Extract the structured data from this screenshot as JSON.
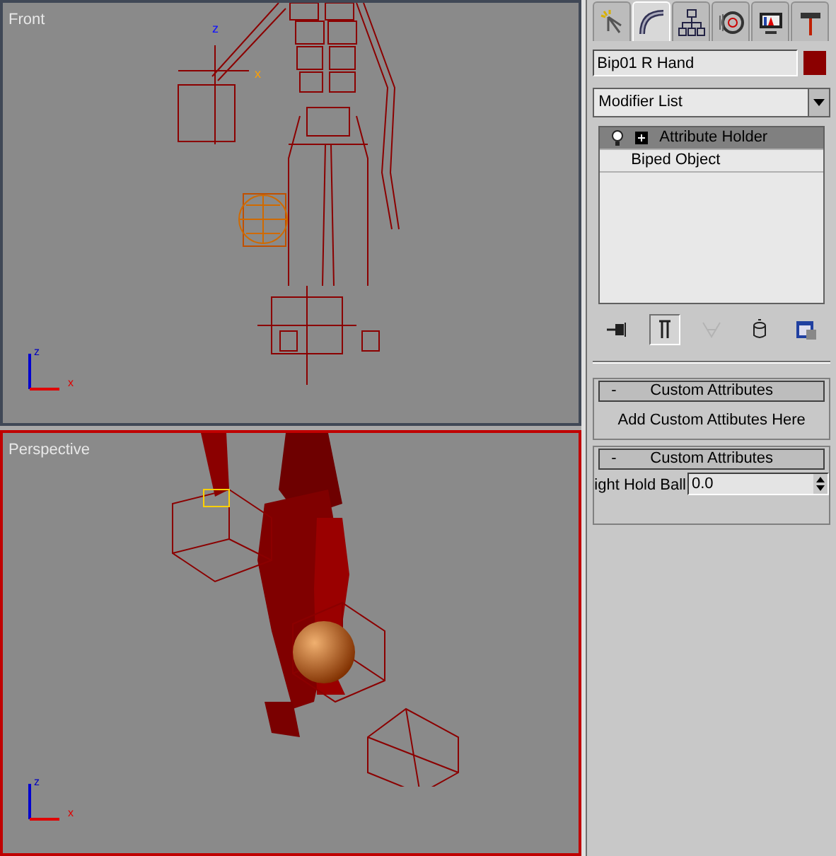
{
  "viewports": [
    {
      "title": "Front",
      "active": false,
      "kind": "front",
      "gizmo_labels": [
        "z",
        "x"
      ],
      "axis_labels": [
        "z",
        "x"
      ]
    },
    {
      "title": "Perspective",
      "active": true,
      "kind": "perspective",
      "axis_labels": [
        "z",
        "x"
      ]
    }
  ],
  "panel": {
    "tabs": [
      {
        "kind": "create",
        "selected": false
      },
      {
        "kind": "modify",
        "selected": true
      },
      {
        "kind": "hierarchy",
        "selected": false
      },
      {
        "kind": "motion",
        "selected": false
      },
      {
        "kind": "display",
        "selected": false
      },
      {
        "kind": "utilities",
        "selected": false
      }
    ],
    "object_name": "Bip01 R Hand",
    "modifier_list": "Modifier List",
    "stack_items": [
      {
        "label": "Attribute Holder",
        "selected": true,
        "expandable": true
      },
      {
        "label": "Biped Object",
        "selected": false,
        "expandable": false
      }
    ],
    "stack_toolbar": [
      {
        "kind": "pin",
        "selected": false,
        "disabled": false
      },
      {
        "kind": "show-end",
        "selected": true,
        "disabled": false
      },
      {
        "kind": "unique",
        "selected": false,
        "disabled": true
      },
      {
        "kind": "remove",
        "selected": false,
        "disabled": false
      },
      {
        "kind": "configure",
        "selected": false,
        "disabled": false
      }
    ],
    "rollouts": [
      {
        "sign": "-",
        "title": "Custom Attributes",
        "expanded": true,
        "kind": "button",
        "text": "Add Custom Attibutes Here"
      },
      {
        "sign": "-",
        "title": "Custom Attributes",
        "expanded": true,
        "kind": "spinner",
        "label": "ight Hold Ball",
        "value": "0.0"
      }
    ]
  }
}
